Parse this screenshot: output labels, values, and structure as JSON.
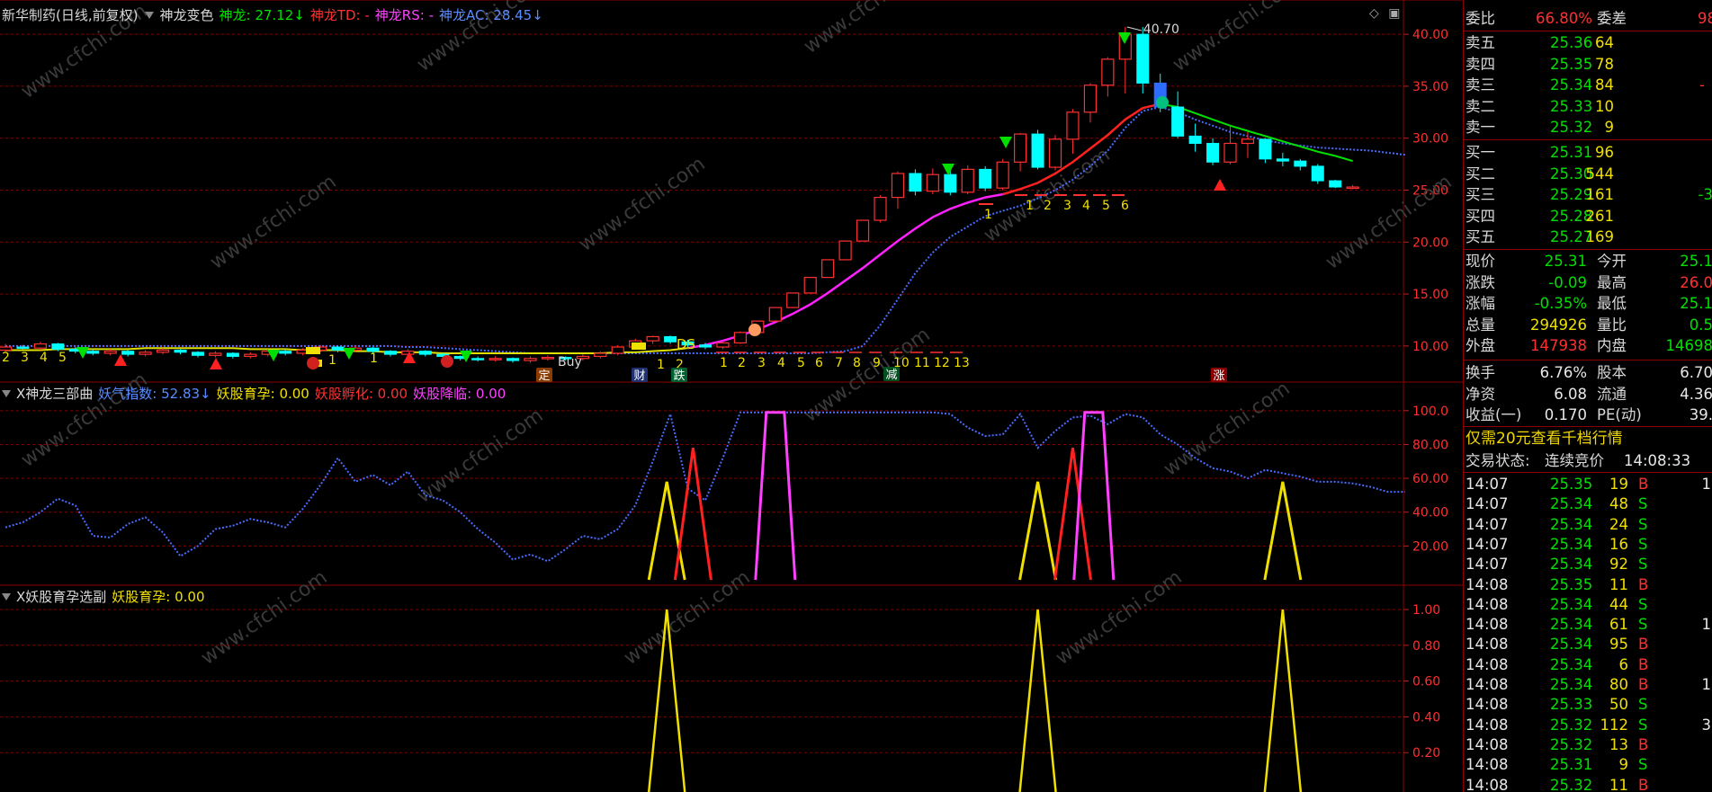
{
  "main_panel": {
    "title_parts": [
      {
        "text": "新华制药(日线,前复权)",
        "color": "#d8d8d8"
      },
      {
        "text": "神龙变色",
        "color": "#d8d8d8"
      },
      {
        "text": "神龙: 27.12↓",
        "color": "#00e000"
      },
      {
        "text": "神龙TD: -",
        "color": "#ff3030"
      },
      {
        "text": "神龙RS: -",
        "color": "#ff40ff"
      },
      {
        "text": "神龙AC: 28.45↓",
        "color": "#5a8cff"
      }
    ],
    "high_label": "40.70",
    "y_axis_labels": [
      "40.00",
      "35.00",
      "30.00",
      "25.00",
      "20.00",
      "15.00",
      "10.00"
    ],
    "count_labels_left": [
      "2",
      "3",
      "4",
      "5"
    ],
    "count_labels_mid": [
      "1",
      "1",
      "1",
      "2"
    ],
    "count_labels_seq": [
      "1",
      "2",
      "3",
      "4",
      "5",
      "6",
      "7",
      "8",
      "9",
      "10",
      "11",
      "12",
      "13"
    ],
    "count_labels_top": [
      "1",
      "2",
      "3",
      "4",
      "5",
      "6"
    ],
    "count_label_one": "1",
    "signal_labels": {
      "ding": "定",
      "cai": "财",
      "die": "跌",
      "jian": "减",
      "zhang": "涨",
      "ds": "DS",
      "buy": "Buy"
    }
  },
  "sub_panel_1": {
    "title_parts": [
      {
        "text": "X神龙三部曲",
        "color": "#d8d8d8"
      },
      {
        "text": "妖气指数: 52.83↓",
        "color": "#5a8cff"
      },
      {
        "text": "妖股育孕: 0.00",
        "color": "#f0e000"
      },
      {
        "text": "妖股孵化: 0.00",
        "color": "#ff3030"
      },
      {
        "text": "妖股降临: 0.00",
        "color": "#ff40ff"
      }
    ],
    "y_axis_labels": [
      "100.0",
      "80.00",
      "60.00",
      "40.00",
      "20.00"
    ]
  },
  "sub_panel_2": {
    "title_parts": [
      {
        "text": "X妖股育孕选副",
        "color": "#d8d8d8"
      },
      {
        "text": "妖股育孕: 0.00",
        "color": "#f0e000"
      }
    ],
    "y_axis_labels": [
      "1.00",
      "0.80",
      "0.60",
      "0.40",
      "0.20"
    ]
  },
  "chart_data": {
    "type": "candlestick",
    "watermark": "www.cfchi.com",
    "main_ylim": [
      8,
      42
    ],
    "yaoqi_ylim": [
      0,
      110
    ],
    "yaoqi_index": [
      31,
      34,
      40,
      48,
      44,
      26,
      25,
      33,
      37,
      28,
      14,
      20,
      30,
      32,
      36,
      34,
      31,
      42,
      56,
      72,
      58,
      62,
      56,
      64,
      50,
      47,
      40,
      30,
      22,
      12,
      15,
      11,
      18,
      26,
      24,
      30,
      44,
      70,
      98,
      54,
      47,
      72,
      99,
      99,
      99,
      99,
      99,
      99,
      99,
      99,
      99,
      99,
      99,
      99,
      98,
      90,
      85,
      86,
      98,
      78,
      88,
      96,
      97,
      92,
      98,
      96,
      86,
      80,
      72,
      66,
      64,
      60,
      65,
      63,
      61,
      58,
      58,
      57,
      55,
      52,
      52
    ],
    "shenlong_ma": [
      9.6,
      9.6,
      9.6,
      9.7,
      9.7,
      9.7,
      9.7,
      9.7,
      9.8,
      9.8,
      9.8,
      9.8,
      9.8,
      9.8,
      9.7,
      9.7,
      9.7,
      9.6,
      9.6,
      9.6,
      9.5,
      9.5,
      9.4,
      9.4,
      9.4,
      9.3,
      9.3,
      9.3,
      9.3,
      9.3,
      9.3,
      9.3,
      9.3,
      9.3,
      9.3,
      9.4,
      9.4,
      9.5,
      9.6,
      9.8,
      10.1,
      10.5,
      11.0,
      11.6,
      12.3,
      13.1,
      14.0,
      15.1,
      16.3,
      17.5,
      18.8,
      20.1,
      21.3,
      22.4,
      23.2,
      23.8,
      24.3,
      24.6,
      25.1,
      25.7,
      26.6,
      27.7,
      29.0,
      30.3,
      31.8,
      32.9,
      33.3,
      33.0,
      32.4,
      31.8,
      31.2,
      30.7,
      30.2,
      29.7,
      29.2,
      28.7,
      28.3,
      27.8,
      27.4,
      27.1,
      27.0
    ],
    "ac_line": [
      10.0,
      10.0,
      10.0,
      10.0,
      10.0,
      10.0,
      10.0,
      10.0,
      10.0,
      10.0,
      10.0,
      10.0,
      10.0,
      10.0,
      10.0,
      10.0,
      10.0,
      10.0,
      10.0,
      10.0,
      10.0,
      10.0,
      10.0,
      9.9,
      9.9,
      9.8,
      9.7,
      9.6,
      9.5,
      9.4,
      9.3,
      9.3,
      9.3,
      9.3,
      9.3,
      9.3,
      9.3,
      9.3,
      9.3,
      9.3,
      9.3,
      9.3,
      9.3,
      9.3,
      9.3,
      9.3,
      9.3,
      9.4,
      9.5,
      10.0,
      12.0,
      14.5,
      17.0,
      19.0,
      20.5,
      21.5,
      22.5,
      23.0,
      23.5,
      24.2,
      25.0,
      26.0,
      27.3,
      28.8,
      31.0,
      32.6,
      33.0,
      32.5,
      31.8,
      31.2,
      30.6,
      30.2,
      29.8,
      29.5,
      29.3,
      29.1,
      29.0,
      28.9,
      28.8,
      28.6,
      28.4
    ],
    "candles": [
      [
        9.6,
        9.9,
        10.2,
        9.4
      ],
      [
        9.9,
        9.8,
        10.1,
        9.5
      ],
      [
        9.8,
        10.2,
        10.4,
        9.6
      ],
      [
        10.2,
        9.7,
        10.3,
        9.5
      ],
      [
        9.7,
        9.5,
        9.9,
        9.3
      ],
      [
        9.5,
        9.3,
        9.7,
        9.1
      ],
      [
        9.3,
        9.5,
        9.7,
        9.1
      ],
      [
        9.5,
        9.2,
        9.6,
        9.0
      ],
      [
        9.2,
        9.4,
        9.6,
        9.0
      ],
      [
        9.4,
        9.6,
        9.8,
        9.2
      ],
      [
        9.6,
        9.4,
        9.7,
        9.2
      ],
      [
        9.4,
        9.1,
        9.5,
        8.9
      ],
      [
        9.1,
        9.3,
        9.5,
        8.9
      ],
      [
        9.3,
        9.0,
        9.4,
        8.8
      ],
      [
        9.0,
        9.2,
        9.4,
        8.8
      ],
      [
        9.2,
        9.5,
        9.7,
        9.0
      ],
      [
        9.5,
        9.3,
        9.7,
        9.1
      ],
      [
        9.3,
        9.6,
        9.8,
        9.1
      ],
      [
        9.6,
        9.9,
        10.1,
        9.4
      ],
      [
        9.9,
        9.6,
        10.0,
        9.4
      ],
      [
        9.6,
        9.8,
        10.0,
        9.4
      ],
      [
        9.8,
        9.5,
        9.9,
        9.3
      ],
      [
        9.5,
        9.2,
        9.6,
        9.0
      ],
      [
        9.2,
        9.5,
        9.7,
        9.0
      ],
      [
        9.5,
        9.2,
        9.6,
        9.0
      ],
      [
        9.2,
        9.0,
        9.3,
        8.8
      ],
      [
        9.0,
        8.8,
        9.1,
        8.6
      ],
      [
        8.8,
        8.7,
        9.0,
        8.5
      ],
      [
        8.7,
        8.8,
        9.0,
        8.5
      ],
      [
        8.8,
        8.6,
        8.9,
        8.4
      ],
      [
        8.6,
        8.8,
        9.0,
        8.4
      ],
      [
        8.8,
        8.9,
        9.1,
        8.6
      ],
      [
        8.9,
        8.8,
        9.0,
        8.6
      ],
      [
        8.8,
        9.0,
        9.2,
        8.6
      ],
      [
        9.0,
        9.3,
        9.5,
        8.8
      ],
      [
        9.3,
        9.9,
        10.1,
        9.1
      ],
      [
        9.9,
        10.5,
        10.7,
        9.7
      ],
      [
        10.5,
        10.9,
        11.0,
        10.2
      ],
      [
        10.9,
        10.4,
        11.0,
        10.2
      ],
      [
        10.4,
        10.1,
        10.6,
        9.9
      ],
      [
        10.1,
        9.9,
        10.3,
        9.7
      ],
      [
        9.9,
        10.3,
        10.5,
        9.7
      ],
      [
        10.3,
        11.3,
        11.4,
        10.2
      ],
      [
        11.3,
        12.4,
        12.4,
        11.3
      ],
      [
        12.4,
        13.7,
        13.7,
        12.4
      ],
      [
        13.7,
        15.1,
        15.1,
        13.7
      ],
      [
        15.1,
        16.6,
        16.6,
        15.1
      ],
      [
        16.6,
        18.3,
        18.3,
        16.6
      ],
      [
        18.3,
        20.1,
        20.1,
        18.3
      ],
      [
        20.1,
        22.1,
        22.1,
        20.1
      ],
      [
        22.1,
        24.3,
        24.5,
        21.9
      ],
      [
        24.3,
        26.6,
        26.8,
        23.2
      ],
      [
        26.6,
        24.9,
        27.0,
        24.5
      ],
      [
        24.9,
        26.5,
        27.1,
        24.6
      ],
      [
        26.5,
        24.8,
        27.0,
        24.5
      ],
      [
        24.8,
        27.0,
        27.4,
        24.6
      ],
      [
        27.0,
        25.2,
        27.3,
        24.9
      ],
      [
        25.2,
        27.7,
        28.0,
        25.0
      ],
      [
        27.7,
        30.4,
        30.5,
        26.8
      ],
      [
        30.4,
        27.2,
        30.8,
        27.0
      ],
      [
        27.2,
        29.9,
        30.3,
        26.9
      ],
      [
        29.9,
        32.5,
        32.8,
        28.5
      ],
      [
        32.5,
        35.1,
        35.3,
        31.5
      ],
      [
        35.1,
        37.6,
        37.8,
        34.0
      ],
      [
        37.6,
        40.0,
        40.7,
        34.3
      ],
      [
        40.0,
        35.3,
        40.7,
        34.3
      ],
      [
        35.3,
        33.0,
        36.2,
        32.5
      ],
      [
        33.0,
        30.2,
        34.5,
        30.0
      ],
      [
        30.2,
        29.5,
        31.4,
        28.7
      ],
      [
        29.5,
        27.7,
        30.0,
        27.4
      ],
      [
        27.7,
        29.5,
        31.1,
        27.5
      ],
      [
        29.5,
        29.9,
        30.6,
        28.1
      ],
      [
        29.9,
        28.0,
        30.0,
        27.6
      ],
      [
        28.0,
        27.8,
        28.6,
        27.3
      ],
      [
        27.8,
        27.3,
        28.0,
        26.9
      ],
      [
        27.3,
        25.9,
        27.5,
        25.6
      ],
      [
        25.9,
        25.3,
        26.0,
        25.2
      ],
      [
        25.3,
        25.3,
        25.5,
        25.1
      ]
    ],
    "fuyun_peaks": [
      {
        "center": 37.8,
        "height": 58,
        "color": "#f0e000"
      },
      {
        "center": 39.3,
        "height": 78,
        "color": "#ff2020"
      },
      {
        "center": 44.0,
        "height": 99,
        "color": "#ff40ff"
      },
      {
        "center": 59.0,
        "height": 58,
        "color": "#f0e000"
      },
      {
        "center": 61.0,
        "height": 78,
        "color": "#ff2020"
      },
      {
        "center": 62.2,
        "height": 99,
        "color": "#ff40ff"
      },
      {
        "center": 73.0,
        "height": 58,
        "color": "#f0e000"
      }
    ],
    "yuyun_peaks": [
      37.8,
      59.0,
      73.0
    ]
  },
  "quote_panel": {
    "weibi": {
      "label": "委比",
      "value": "66.80%",
      "label2": "委差",
      "value2": "98"
    },
    "asks": [
      {
        "label": "卖五",
        "price": "25.36",
        "vol": "64"
      },
      {
        "label": "卖四",
        "price": "25.35",
        "vol": "78"
      },
      {
        "label": "卖三",
        "price": "25.34",
        "vol": "84"
      },
      {
        "label": "卖二",
        "price": "25.33",
        "vol": "10"
      },
      {
        "label": "卖一",
        "price": "25.32",
        "vol": "9"
      }
    ],
    "bids": [
      {
        "label": "买一",
        "price": "25.31",
        "vol": "96"
      },
      {
        "label": "买二",
        "price": "25.30",
        "vol": "544"
      },
      {
        "label": "买三",
        "price": "25.29",
        "vol": "161",
        "extra": "-3"
      },
      {
        "label": "买四",
        "price": "25.28",
        "vol": "261"
      },
      {
        "label": "买五",
        "price": "25.27",
        "vol": "169"
      }
    ],
    "stats": [
      {
        "l1": "现价",
        "v1": "25.31",
        "c1": "green",
        "l2": "今开",
        "v2": "25.1",
        "c2": "green"
      },
      {
        "l1": "涨跌",
        "v1": "-0.09",
        "c1": "green",
        "l2": "最高",
        "v2": "26.0",
        "c2": "red"
      },
      {
        "l1": "涨幅",
        "v1": "-0.35%",
        "c1": "green",
        "l2": "最低",
        "v2": "25.1",
        "c2": "green"
      },
      {
        "l1": "总量",
        "v1": "294926",
        "c1": "yellow",
        "l2": "量比",
        "v2": "0.5",
        "c2": "green"
      },
      {
        "l1": "外盘",
        "v1": "147938",
        "c1": "red",
        "l2": "内盘",
        "v2": "14698",
        "c2": "green"
      }
    ],
    "stats2": [
      {
        "l1": "换手",
        "v1": "6.76%",
        "l2": "股本",
        "v2": "6.70"
      },
      {
        "l1": "净资",
        "v1": "6.08",
        "l2": "流通",
        "v2": "4.36"
      },
      {
        "l1": "收益(一)",
        "v1": "0.170",
        "l2": "PE(动)",
        "v2": "39."
      }
    ],
    "promo": "仅需20元查看千档行情",
    "trade_status": {
      "label": "交易状态:",
      "value": "连续竞价",
      "time": "14:08:33"
    },
    "ticks": [
      {
        "t": "14:07",
        "p": "25.35",
        "v": "19",
        "d": "B",
        "x": "1"
      },
      {
        "t": "14:07",
        "p": "25.34",
        "v": "48",
        "d": "S",
        "x": ""
      },
      {
        "t": "14:07",
        "p": "25.34",
        "v": "24",
        "d": "S",
        "x": ""
      },
      {
        "t": "14:07",
        "p": "25.34",
        "v": "16",
        "d": "S",
        "x": ""
      },
      {
        "t": "14:07",
        "p": "25.34",
        "v": "92",
        "d": "S",
        "x": ""
      },
      {
        "t": "14:08",
        "p": "25.35",
        "v": "11",
        "d": "B",
        "x": ""
      },
      {
        "t": "14:08",
        "p": "25.34",
        "v": "44",
        "d": "S",
        "x": ""
      },
      {
        "t": "14:08",
        "p": "25.34",
        "v": "61",
        "d": "S",
        "x": "1"
      },
      {
        "t": "14:08",
        "p": "25.34",
        "v": "95",
        "d": "B",
        "x": ""
      },
      {
        "t": "14:08",
        "p": "25.34",
        "v": "6",
        "d": "B",
        "x": ""
      },
      {
        "t": "14:08",
        "p": "25.34",
        "v": "80",
        "d": "B",
        "x": "1"
      },
      {
        "t": "14:08",
        "p": "25.33",
        "v": "50",
        "d": "S",
        "x": ""
      },
      {
        "t": "14:08",
        "p": "25.32",
        "v": "112",
        "d": "S",
        "x": "3"
      },
      {
        "t": "14:08",
        "p": "25.32",
        "v": "13",
        "d": "B",
        "x": ""
      },
      {
        "t": "14:08",
        "p": "25.31",
        "v": "9",
        "d": "S",
        "x": ""
      },
      {
        "t": "14:08",
        "p": "25.32",
        "v": "11",
        "d": "B",
        "x": ""
      }
    ]
  }
}
